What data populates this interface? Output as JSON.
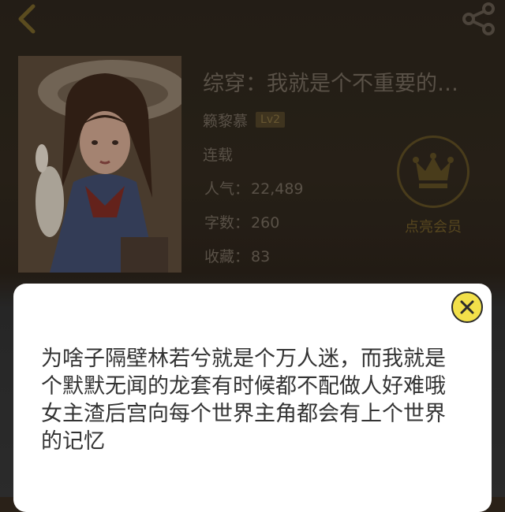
{
  "header": {
    "back_icon": "chevron-left-icon",
    "share_icon": "share-icon"
  },
  "book": {
    "title": "综穿：我就是个不重要的…",
    "author": "籁黎慕",
    "level": "Lv2",
    "status": "连载",
    "popularity_label": "人气：",
    "popularity": "22,489",
    "word_count_label": "字数：",
    "word_count": "260",
    "favorites_label": "收藏：",
    "favorites": "83"
  },
  "vip": {
    "icon": "crown-icon",
    "label": "点亮会员"
  },
  "modal": {
    "close_icon": "close-icon",
    "lines": [
      "为啥子隔壁林若兮就是个万人迷，而我就是个默默无闻的龙套有时候都不配做人好难哦",
      "女主渣后宫向每个世界主角都会有上个世界的记忆"
    ]
  },
  "colors": {
    "accent": "#f2e04a",
    "dim_text": "#6d6357",
    "vip_gold": "#5a4a22"
  }
}
